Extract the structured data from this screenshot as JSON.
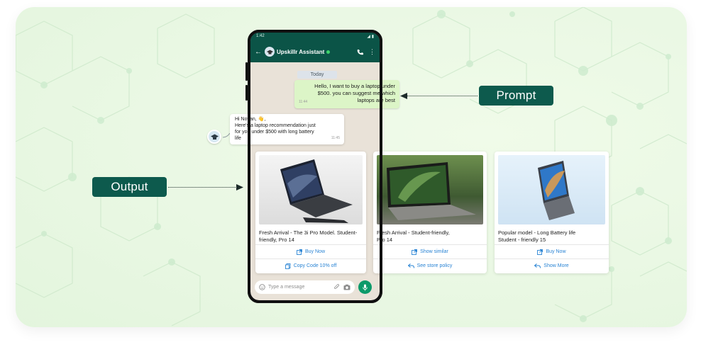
{
  "labels": {
    "prompt": "Prompt",
    "output": "Output"
  },
  "phone": {
    "status_time": "1:42",
    "contact_name": "Upskillr Assistant",
    "date_chip": "Today",
    "input_placeholder": "Type a message"
  },
  "messages": {
    "user": {
      "lines": [
        "Hello, I want to buy a laptop under",
        "$500. you can suggest me which",
        "laptops are best"
      ],
      "time": "11:44"
    },
    "bot": {
      "lines": [
        "Hi Novan, 👋,",
        "Here's a laptop recommendation just",
        "for you under $500 with long battery",
        "life"
      ],
      "time": "11:45"
    }
  },
  "cards": [
    {
      "desc_lines": [
        "Fresh Arrival - The 3i Pro Model. Student-",
        "friendly, Pro 14"
      ],
      "btn1": "Buy Now",
      "btn1_icon": "external-link-icon",
      "btn2": "Copy Code 10% off",
      "btn2_icon": "copy-icon"
    },
    {
      "desc_lines": [
        "Fresh Arrival - Student-friendly,",
        "Pro 14"
      ],
      "btn1": "Show similar",
      "btn1_icon": "external-link-icon",
      "btn2": "See store policy",
      "btn2_icon": "reply-icon"
    },
    {
      "desc_lines": [
        "Popular model - Long Battery life",
        "Student - friendly 15"
      ],
      "btn1": "Buy Now",
      "btn1_icon": "external-link-icon",
      "btn2": "Show More",
      "btn2_icon": "reply-icon"
    }
  ],
  "colors": {
    "accent_green": "#0d5a4d",
    "link_blue": "#2a84d4",
    "bubble_out": "#dcf5c7",
    "app_bar": "#0b5447"
  }
}
